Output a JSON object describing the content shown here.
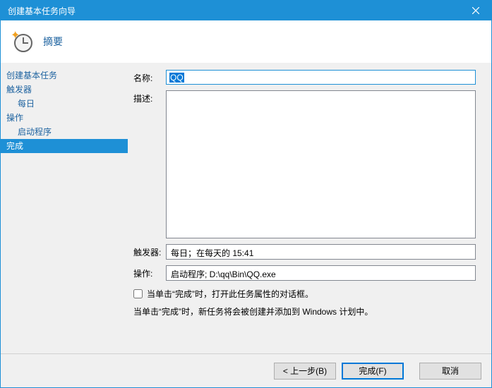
{
  "window": {
    "title": "创建基本任务向导"
  },
  "header": {
    "title": "摘要"
  },
  "sidebar": {
    "items": [
      {
        "label": "创建基本任务",
        "indent": false,
        "selected": false
      },
      {
        "label": "触发器",
        "indent": false,
        "selected": false
      },
      {
        "label": "每日",
        "indent": true,
        "selected": false
      },
      {
        "label": "操作",
        "indent": false,
        "selected": false
      },
      {
        "label": "启动程序",
        "indent": true,
        "selected": false
      },
      {
        "label": "完成",
        "indent": false,
        "selected": true
      }
    ]
  },
  "form": {
    "name_label": "名称:",
    "name_value": "QQ",
    "desc_label": "描述:",
    "desc_value": "",
    "trigger_label": "触发器:",
    "trigger_value": "每日；在每天的 15:41",
    "action_label": "操作:",
    "action_value": "启动程序; D:\\qq\\Bin\\QQ.exe",
    "open_props_label": "当单击“完成”时，打开此任务属性的对话框。",
    "info_text": "当单击“完成”时，新任务将会被创建并添加到 Windows 计划中。"
  },
  "buttons": {
    "back": "< 上一步(B)",
    "finish": "完成(F)",
    "cancel": "取消"
  }
}
